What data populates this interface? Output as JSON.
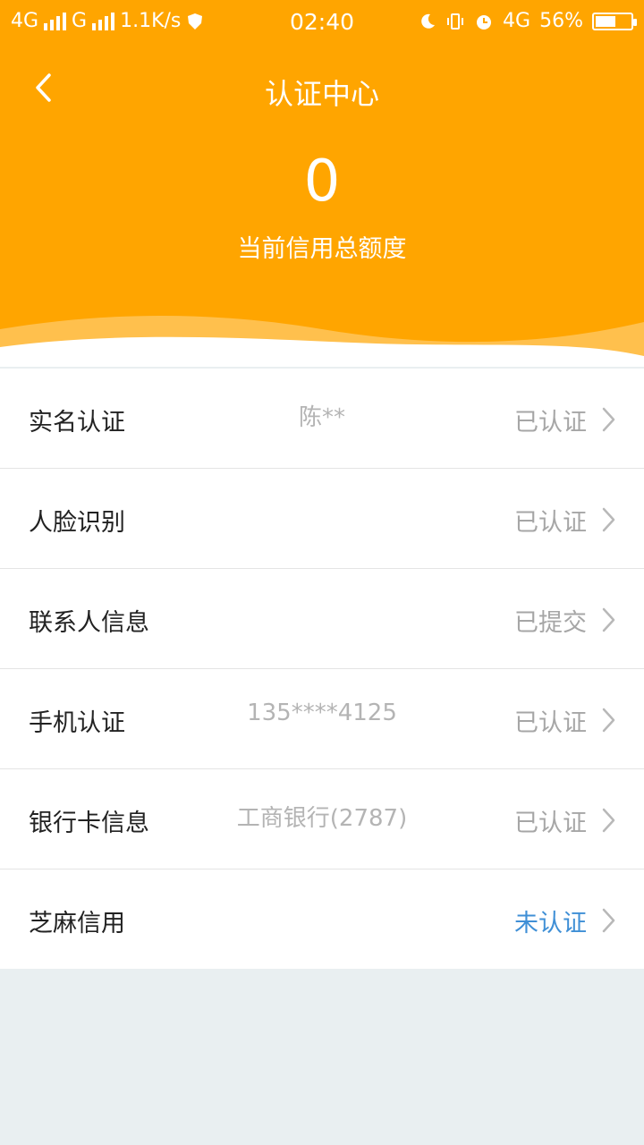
{
  "status_bar": {
    "network1": "4G",
    "network2": "G",
    "speed": "1.1K/s",
    "time": "02:40",
    "network3": "4G",
    "battery": "56%"
  },
  "header": {
    "title": "认证中心",
    "amount": "0",
    "amount_label": "当前信用总额度",
    "accent_color": "#ffa500"
  },
  "items": [
    {
      "label": "实名认证",
      "info": "陈**",
      "status": "已认证"
    },
    {
      "label": "人脸识别",
      "info": "",
      "status": "已认证"
    },
    {
      "label": "联系人信息",
      "info": "",
      "status": "已提交"
    },
    {
      "label": "手机认证",
      "info": "135****4125",
      "status": "已认证"
    },
    {
      "label": "银行卡信息",
      "info": "工商银行(2787)",
      "status": "已认证"
    },
    {
      "label": "芝麻信用",
      "info": "",
      "status": "未认证",
      "status_color": "#3f8fd6"
    }
  ]
}
